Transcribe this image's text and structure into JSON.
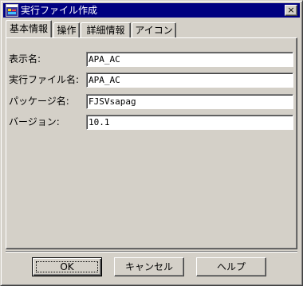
{
  "window": {
    "title": "実行ファイル作成",
    "close_label": "×",
    "title_bar_color": "#000080",
    "face_color": "#d4d0c8"
  },
  "tabs": [
    {
      "label": "基本情報",
      "selected": true
    },
    {
      "label": "操作",
      "selected": false
    },
    {
      "label": "詳細情報",
      "selected": false
    },
    {
      "label": "アイコン",
      "selected": false
    }
  ],
  "form": {
    "display_name": {
      "label": "表示名:",
      "value": "APA_AC"
    },
    "exec_file_name": {
      "label": "実行ファイル名:",
      "value": "APA_AC"
    },
    "package_name": {
      "label": "パッケージ名:",
      "value": "FJSVsapag"
    },
    "version": {
      "label": "バージョン:",
      "value": "10.1"
    }
  },
  "buttons": {
    "ok": "OK",
    "cancel": "キャンセル",
    "help": "ヘルプ"
  },
  "icons": {
    "app": "app-window-icon",
    "close": "close-icon"
  }
}
